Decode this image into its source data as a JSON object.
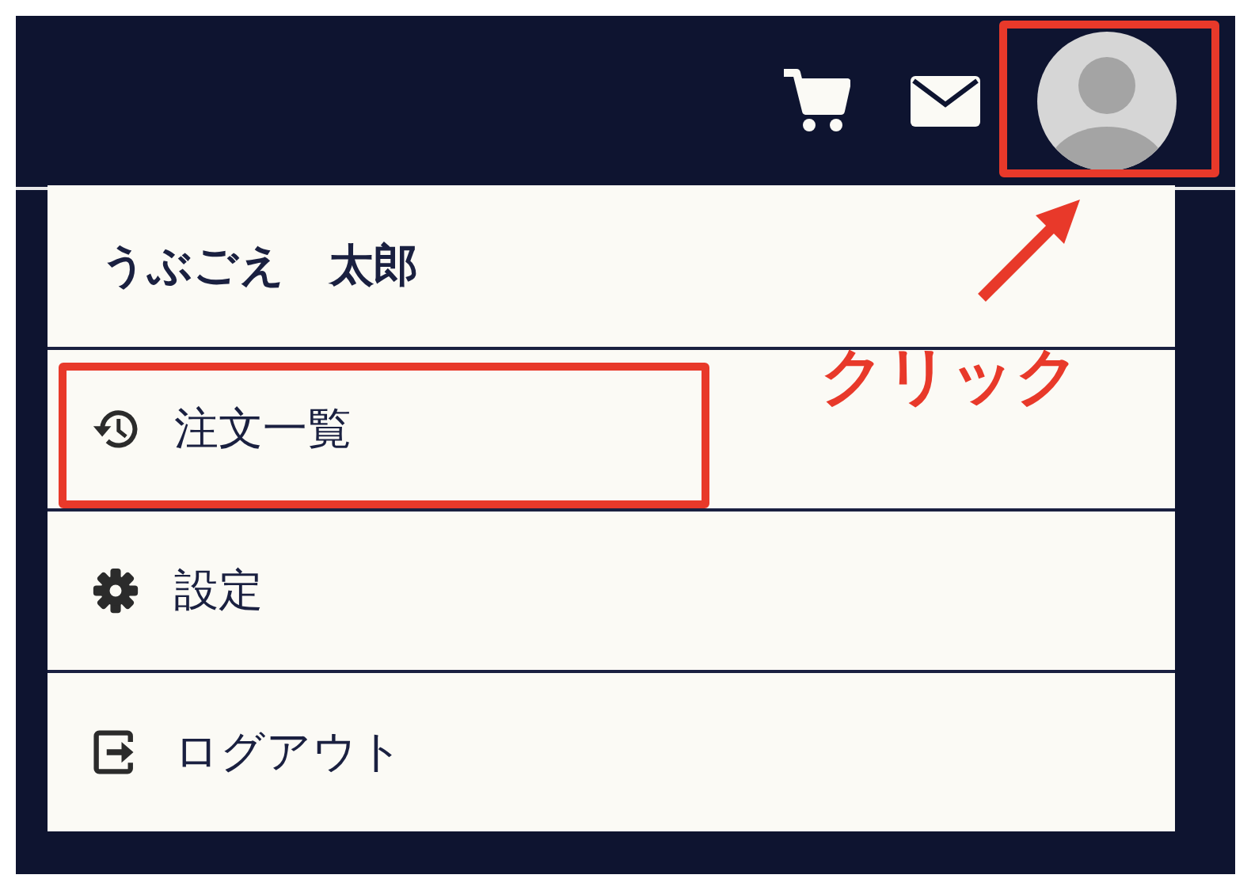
{
  "header": {
    "icons": [
      {
        "kind": "cart"
      },
      {
        "kind": "mail"
      },
      {
        "kind": "avatar"
      }
    ]
  },
  "menu": {
    "user_name": "うぶごえ　太郎",
    "items": [
      {
        "kind": "history",
        "label": "注文一覧",
        "highlighted": true
      },
      {
        "kind": "gear",
        "label": "設定",
        "highlighted": false
      },
      {
        "kind": "logout",
        "label": "ログアウト",
        "highlighted": false
      }
    ]
  },
  "annotation": {
    "label": "クリック"
  }
}
